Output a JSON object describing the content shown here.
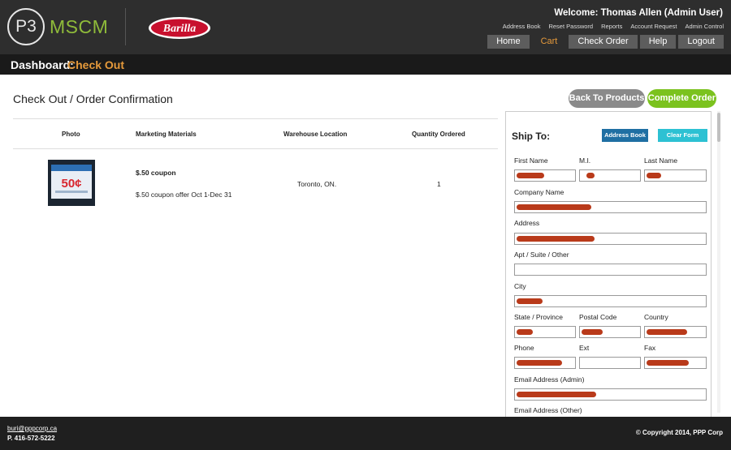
{
  "header": {
    "logo_mark": "P3",
    "logo_text": "MSCM",
    "brand": "Barilla",
    "welcome": "Welcome: Thomas Allen (Admin User)",
    "top_links": [
      "Address Book",
      "Reset Password",
      "Reports",
      "Account Request",
      "Admin Control"
    ],
    "nav": [
      "Home",
      "Cart",
      "Check Order",
      "Help",
      "Logout"
    ],
    "active_nav": "Cart"
  },
  "crumb": {
    "label": "Dashboard:",
    "current": "Check Out"
  },
  "main": {
    "title": "Check Out / Order Confirmation",
    "back_button": "Back To Products",
    "complete_button": "Complete Order",
    "columns": [
      "Photo",
      "Marketing Materials",
      "Warehouse Location",
      "Quantity Ordered"
    ],
    "rows": [
      {
        "image_caption": "50¢",
        "name": "$.50 coupon",
        "description": "$.50 coupon offer Oct 1-Dec 31",
        "warehouse": "Toronto, ON.",
        "quantity": "1"
      }
    ]
  },
  "ship_panel": {
    "title": "Ship To:",
    "address_book_button": "Address Book",
    "clear_form_button": "Clear Form",
    "labels": {
      "first_name": "First Name",
      "mi": "M.I.",
      "last_name": "Last Name",
      "company": "Company Name",
      "address": "Address",
      "apt": "Apt / Suite / Other",
      "city": "City",
      "state": "State / Province",
      "postal": "Postal Code",
      "country": "Country",
      "phone": "Phone",
      "ext": "Ext",
      "fax": "Fax",
      "email": "Email Address (Admin)",
      "email_other": "Email Address (Other)"
    }
  },
  "footer": {
    "email": "buri@pppcorp.ca",
    "phone": "P. 416-572-5222",
    "copyright": "© Copyright 2014, PPP Corp"
  },
  "colors": {
    "accent_orange": "#e69a3b",
    "green": "#7bc21e",
    "blue": "#1f6fa3",
    "cyan": "#2dc1d3",
    "redaction": "#b93a1a"
  }
}
